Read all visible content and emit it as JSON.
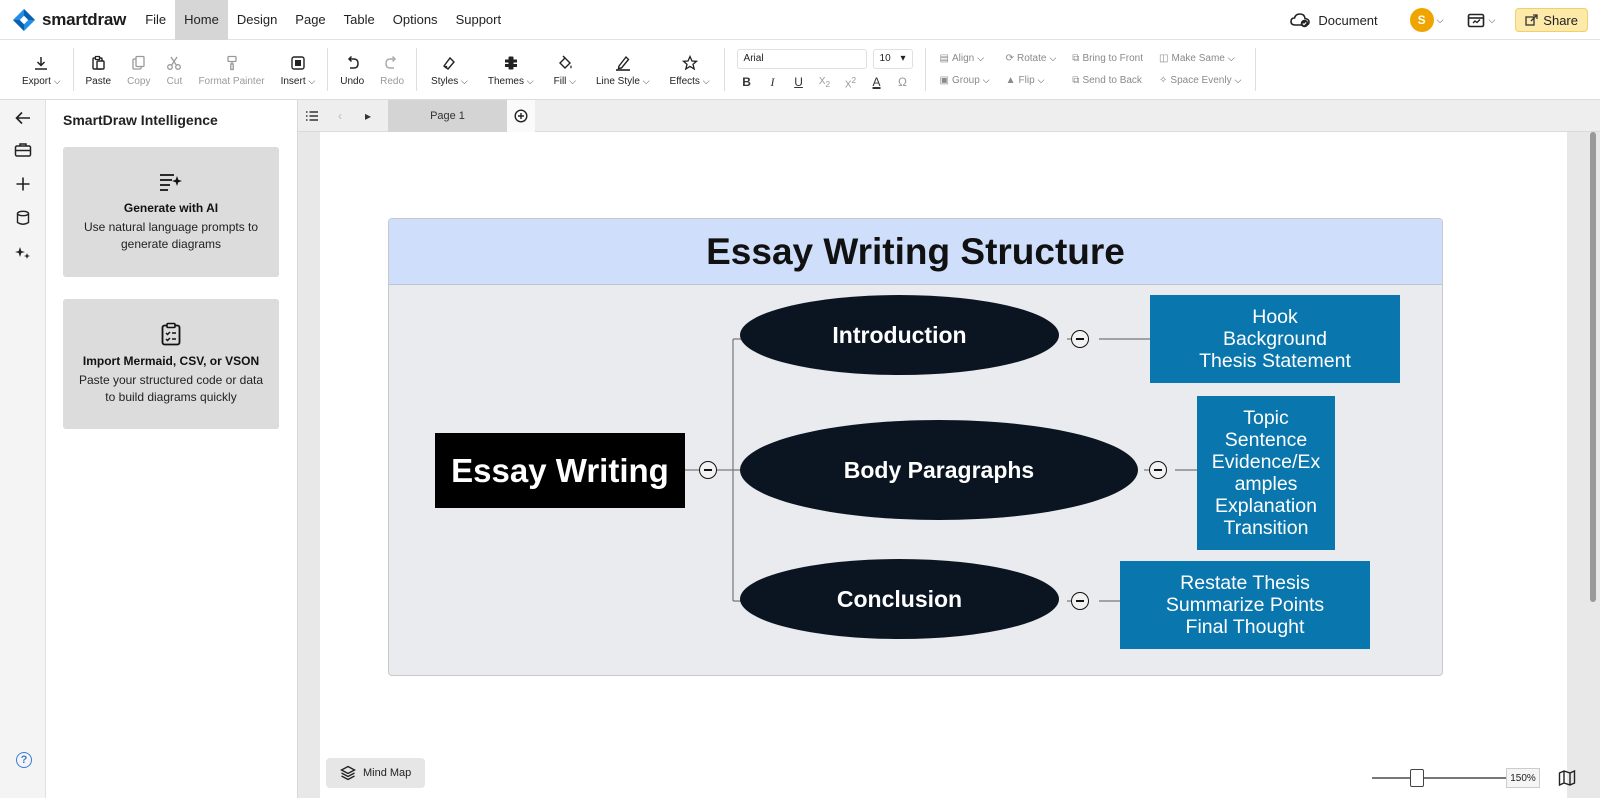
{
  "app": {
    "name": "smartdraw"
  },
  "menu": [
    "File",
    "Home",
    "Design",
    "Page",
    "Table",
    "Options",
    "Support"
  ],
  "menu_active": "Home",
  "header_right": {
    "document_label": "Document",
    "avatar_initial": "S",
    "share_label": "Share"
  },
  "toolbar": {
    "export": "Export",
    "paste": "Paste",
    "copy": "Copy",
    "cut": "Cut",
    "format_painter": "Format Painter",
    "insert": "Insert",
    "undo": "Undo",
    "redo": "Redo",
    "styles": "Styles",
    "themes": "Themes",
    "fill": "Fill",
    "line_style": "Line Style",
    "effects": "Effects",
    "font_name": "Arial",
    "font_size": "10",
    "align": "Align",
    "rotate": "Rotate",
    "bring_to_front": "Bring to Front",
    "make_same": "Make Same",
    "group": "Group",
    "flip": "Flip",
    "send_to_back": "Send to Back",
    "space_evenly": "Space Evenly"
  },
  "panel": {
    "title": "SmartDraw Intelligence",
    "cards": [
      {
        "title": "Generate with AI",
        "desc": "Use natural language prompts to generate diagrams"
      },
      {
        "title": "Import Mermaid, CSV, or VSON",
        "desc": "Paste your structured code or data to build diagrams quickly"
      }
    ]
  },
  "pages": {
    "current": "Page 1"
  },
  "diagram": {
    "title": "Essay Writing Structure",
    "root": "Essay Writing",
    "branches": [
      {
        "label": "Introduction",
        "details": [
          "Hook",
          "Background",
          "Thesis Statement"
        ]
      },
      {
        "label": "Body Paragraphs",
        "details": [
          "Topic",
          "Sentence",
          "Evidence/Ex",
          "amples",
          "Explanation",
          "Transition"
        ]
      },
      {
        "label": "Conclusion",
        "details": [
          "Restate Thesis",
          "Summarize Points",
          "Final Thought"
        ]
      }
    ]
  },
  "bottom": {
    "template_label": "Mind Map",
    "zoom": "150%"
  },
  "colors": {
    "accent_share": "#fde9a8",
    "header_band": "#cfdffb",
    "detail_box": "#0977ad",
    "ellipse": "#0b1522",
    "avatar": "#f0a400"
  }
}
